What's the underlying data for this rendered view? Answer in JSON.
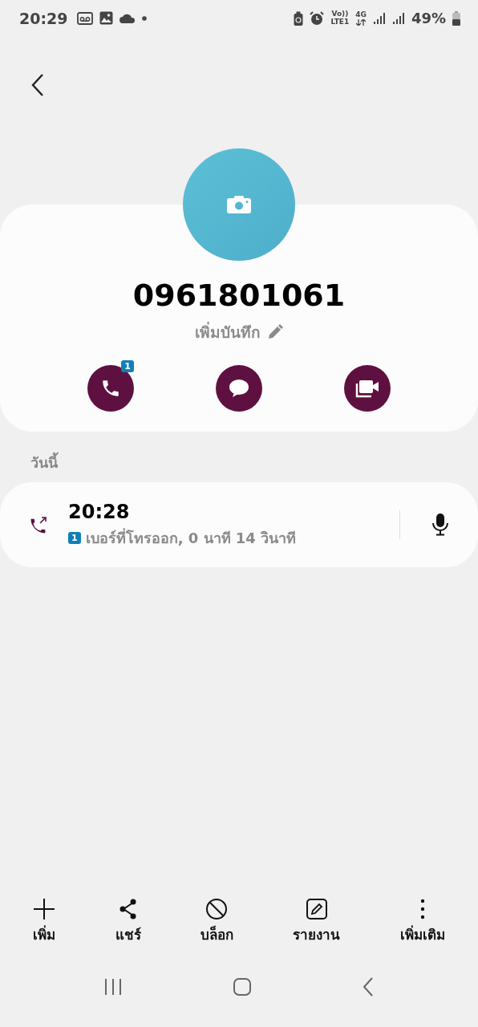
{
  "status_bar": {
    "time": "20:29",
    "volte": "Vo))",
    "lte": "LTE1",
    "network": "4G",
    "battery": "49%"
  },
  "contact": {
    "number": "0961801061",
    "note": "เพิ่มบันทึก"
  },
  "quick_actions": [
    {
      "kind": "call",
      "badge": "1"
    },
    {
      "kind": "message"
    },
    {
      "kind": "video"
    }
  ],
  "history": {
    "section": "วันนี้",
    "entries": [
      {
        "time": "20:28",
        "sim": "1",
        "detail": "เบอร์ที่โทรออก, 0 นาที 14 วินาที"
      }
    ]
  },
  "toolbar": [
    {
      "kind": "add",
      "label": "เพิ่ม"
    },
    {
      "kind": "share",
      "label": "แชร์"
    },
    {
      "kind": "block",
      "label": "บล็อก"
    },
    {
      "kind": "report",
      "label": "รายงาน"
    },
    {
      "kind": "more",
      "label": "เพิ่มเติม"
    }
  ]
}
